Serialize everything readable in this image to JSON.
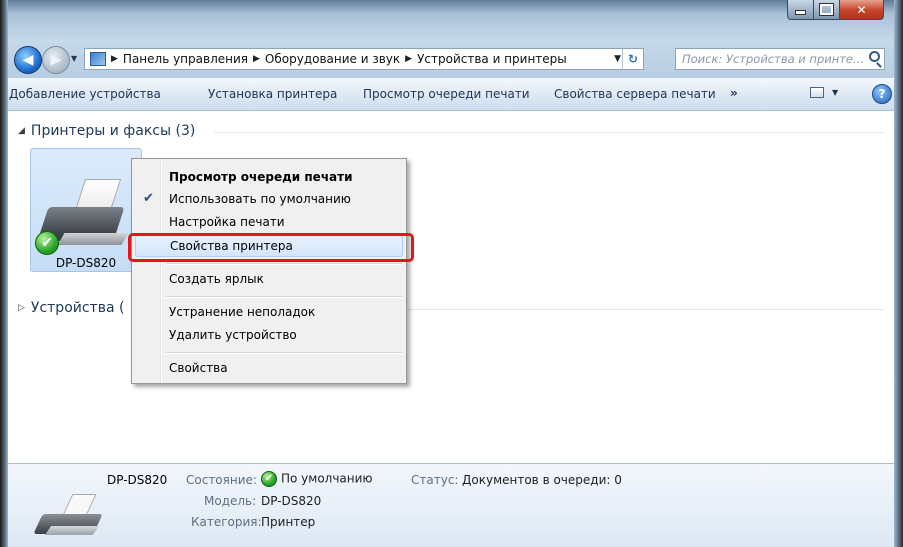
{
  "window": {
    "caption_buttons": {
      "minimize_icon": "minimize-icon",
      "maximize_icon": "maximize-icon",
      "close_icon": "close-icon"
    }
  },
  "nav": {
    "back_glyph": "◀",
    "forward_glyph": "▶",
    "breadcrumb": [
      "Панель управления",
      "Оборудование и звук",
      "Устройства и принтеры"
    ],
    "crumb_separator": "▶",
    "dropdown_glyph": "▼",
    "refresh_glyph": "↻",
    "search_placeholder": "Поиск: Устройства и принте..."
  },
  "commandbar": {
    "add_device": "Добавление устройства",
    "install_printer": "Установка принтера",
    "view_queue": "Просмотр очереди печати",
    "server_properties": "Свойства сервера печати",
    "more": "»",
    "view_drop": "▼",
    "help": "?"
  },
  "groups": {
    "printers": {
      "toggle": "◢",
      "title": "Принтеры и факсы (3)"
    },
    "devices": {
      "toggle": "▷",
      "title": "Устройства ("
    }
  },
  "device": {
    "name": "DP-DS820",
    "badge_glyph": "✔"
  },
  "context_menu": {
    "items": [
      {
        "label": "Просмотр очереди печати",
        "bold": true
      },
      {
        "label": "Использовать по умолчанию",
        "checked": true,
        "check_glyph": "✔"
      },
      {
        "label": "Настройка печати"
      },
      {
        "label": "Свойства принтера",
        "highlighted": true
      },
      {
        "label": "Создать ярлык"
      },
      {
        "label": "Устранение неполадок"
      },
      {
        "label": "Удалить устройство"
      },
      {
        "label": "Свойства"
      }
    ]
  },
  "details": {
    "name": "DP-DS820",
    "state_label": "Состояние:",
    "state_glyph": "✔",
    "state_value": "По умолчанию",
    "status_label": "Статус:",
    "status_value": "Документов в очереди: 0",
    "model_label": "Модель:",
    "model_value": "DP-DS820",
    "category_label": "Категория:",
    "category_value": "Принтер"
  },
  "colors": {
    "highlight_outline": "#e8141b",
    "group_header": "#1e395b",
    "command_text": "#1f3551"
  }
}
